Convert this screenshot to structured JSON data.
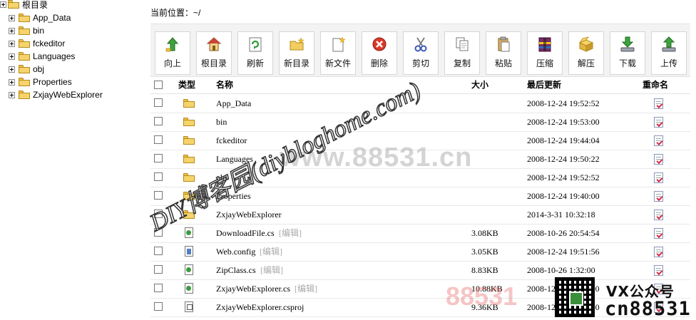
{
  "tree": {
    "root": "根目录",
    "children": [
      "App_Data",
      "bin",
      "fckeditor",
      "Languages",
      "obj",
      "Properties",
      "ZxjayWebExplorer"
    ]
  },
  "location": "当前位置：~/",
  "toolbar": [
    {
      "label": "向上",
      "icon": "up-arrow-icon"
    },
    {
      "label": "根目录",
      "icon": "home-icon"
    },
    {
      "label": "刷新",
      "icon": "refresh-icon"
    },
    {
      "label": "新目录",
      "icon": "new-folder-icon"
    },
    {
      "label": "新文件",
      "icon": "new-file-icon"
    },
    {
      "label": "删除",
      "icon": "delete-icon"
    },
    {
      "label": "剪切",
      "icon": "cut-icon"
    },
    {
      "label": "复制",
      "icon": "copy-icon"
    },
    {
      "label": "粘贴",
      "icon": "paste-icon"
    },
    {
      "label": "压缩",
      "icon": "compress-icon"
    },
    {
      "label": "解压",
      "icon": "extract-icon"
    },
    {
      "label": "下载",
      "icon": "download-icon"
    },
    {
      "label": "上传",
      "icon": "upload-icon"
    }
  ],
  "table": {
    "headers": {
      "type": "类型",
      "name": "名称",
      "size": "大小",
      "modified": "最后更新",
      "rename": "重命名"
    },
    "rows": [
      {
        "type": "folder",
        "name": "App_Data",
        "edit": "",
        "size": "",
        "modified": "2008-12-24 19:52:52"
      },
      {
        "type": "folder",
        "name": "bin",
        "edit": "",
        "size": "",
        "modified": "2008-12-24 19:53:00"
      },
      {
        "type": "folder",
        "name": "fckeditor",
        "edit": "",
        "size": "",
        "modified": "2008-12-24 19:44:04"
      },
      {
        "type": "folder",
        "name": "Languages",
        "edit": "",
        "size": "",
        "modified": "2008-12-24 19:50:22"
      },
      {
        "type": "folder",
        "name": "obj",
        "edit": "",
        "size": "",
        "modified": "2008-12-24 19:52:52"
      },
      {
        "type": "folder",
        "name": "Properties",
        "edit": "",
        "size": "",
        "modified": "2008-12-24 19:40:00"
      },
      {
        "type": "folder",
        "name": "ZxjayWebExplorer",
        "edit": "",
        "size": "",
        "modified": "2014-3-31 10:32:18"
      },
      {
        "type": "cs",
        "name": "DownloadFile.cs",
        "edit": "[编辑]",
        "size": "3.08KB",
        "modified": "2008-10-26 20:54:54"
      },
      {
        "type": "config",
        "name": "Web.config",
        "edit": "[编辑]",
        "size": "3.05KB",
        "modified": "2008-12-24 19:51:56"
      },
      {
        "type": "cs",
        "name": "ZipClass.cs",
        "edit": "[编辑]",
        "size": "8.83KB",
        "modified": "2008-10-26 1:32:00"
      },
      {
        "type": "cs",
        "name": "ZxjayWebExplorer.cs",
        "edit": "[编辑]",
        "size": "10.88KB",
        "modified": "2008-12-24 19:53:00"
      },
      {
        "type": "proj",
        "name": "ZxjayWebExplorer.csproj",
        "edit": "",
        "size": "9.36KB",
        "modified": "2008-12-24 19:53:00"
      }
    ]
  },
  "watermarks": {
    "site": "www.88531.cn",
    "blog": "DIY博客园(diybloghome.com)",
    "bottom": "88531",
    "brand_line1": "VX公众号",
    "brand_line2": "cn88531"
  }
}
